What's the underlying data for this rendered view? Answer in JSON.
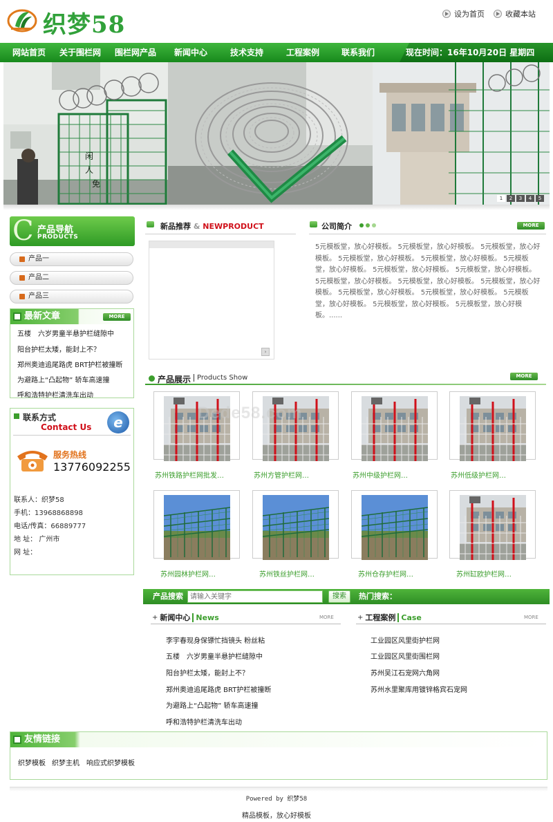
{
  "header": {
    "logo_text": "织梦58",
    "set_home": "设为首页",
    "bookmark": "收藏本站"
  },
  "nav": {
    "items": [
      "网站首页",
      "关于围栏网",
      "围栏网产品",
      "新闻中心",
      "技术支持",
      "工程案例",
      "联系我们"
    ],
    "date": "现在时间：16年10月20日 星期四"
  },
  "banner": {
    "pages": [
      "1",
      "2",
      "3",
      "4",
      "5"
    ]
  },
  "product_nav": {
    "title": "产品导航",
    "subtitle": "PRODUCTS",
    "letter": "C",
    "items": [
      "产品一",
      "产品二",
      "产品三"
    ]
  },
  "latest": {
    "title": "最新文章",
    "more": "MORE",
    "items": [
      "五楼　六岁男童半悬护栏缝隙中",
      "阳台护栏太矮，能封上不？",
      "郑州奥迪追尾路虎 BRT护栏被撞断",
      "为避路上“凸起物” 轿车高速撞",
      "呼和浩特护栏清洗车出动"
    ]
  },
  "contact": {
    "title": "联系方式",
    "title_en": "Contact Us",
    "hotline_label": "服务热线",
    "hotline": "13776092255",
    "lines": [
      "联系人：织梦58",
      "手机：13968868898",
      "电话/传真：66889777",
      "地 址： 广州市",
      "网 址："
    ]
  },
  "new_product": {
    "title": "新品推荐",
    "amp": "&",
    "title_en": "NEWPRODUCT"
  },
  "company": {
    "title": "公司简介",
    "more": "MORE",
    "text": "5元模板堂，放心好模板。 5元模板堂，放心好模板。 5元模板堂，放心好模板。 5元模板堂，放心好模板。 5元模板堂，放心好模板。 5元模板堂，放心好模板。 5元模板堂，放心好模板。 5元模板堂，放心好模板。 5元模板堂，放心好模板。 5元模板堂，放心好模板。 5元模板堂，放心好模板。 5元模板堂，放心好模板。 5元模板堂，放心好模板。 5元模板堂，放心好模板。 5元模板堂，放心好模板。 5元模板堂，放心好模板。......"
  },
  "products": {
    "title": "产品展示",
    "title_en": "Products Show",
    "more": "MORE",
    "items": [
      "苏州铁路护栏网批发…",
      "苏州方管护栏网…",
      "苏州中级护栏网…",
      "苏州低级护栏网…",
      "苏州园林护栏网…",
      "苏州铁丝护栏网…",
      "苏州仓存护栏网…",
      "苏州缸欧护栏网…"
    ]
  },
  "search": {
    "label": "产品搜索",
    "placeholder": "请输入关键字",
    "button": "搜索",
    "hot_label": "热门搜索："
  },
  "news": {
    "title": "新闻中心",
    "title_en": "News",
    "more": "MORE",
    "items": [
      "李宇春现身保镖忙挡镜头 粉丝粘",
      "五楼　六岁男童半悬护栏缝隙中",
      "阳台护栏太矮，能封上不？",
      "郑州奥迪追尾路虎 BRT护栏被撞断",
      "为避路上“凸起物” 轿车高速撞",
      "呼和浩特护栏清洗车出动"
    ]
  },
  "cases": {
    "title": "工程案例",
    "title_en": "Case",
    "more": "MORE",
    "items": [
      "工业园区风里街护栏网",
      "工业园区风里街围栏网",
      "苏州吴江石宠网六角网",
      "苏州水里聚库用镀锌格宾石宠网"
    ]
  },
  "links": {
    "title": "友情链接",
    "items": [
      "织梦模板",
      "织梦主机",
      "响应式织梦模板"
    ]
  },
  "footer": {
    "powered": "Powered by 织梦58",
    "slogan": "精品模板，放心好模板"
  },
  "watermark": "Dede58.com",
  "colors": {
    "brand_green": "#31a13a",
    "nav_green": "#17891c",
    "accent_red": "#d0101a",
    "hotline_orange": "#e2731d"
  }
}
